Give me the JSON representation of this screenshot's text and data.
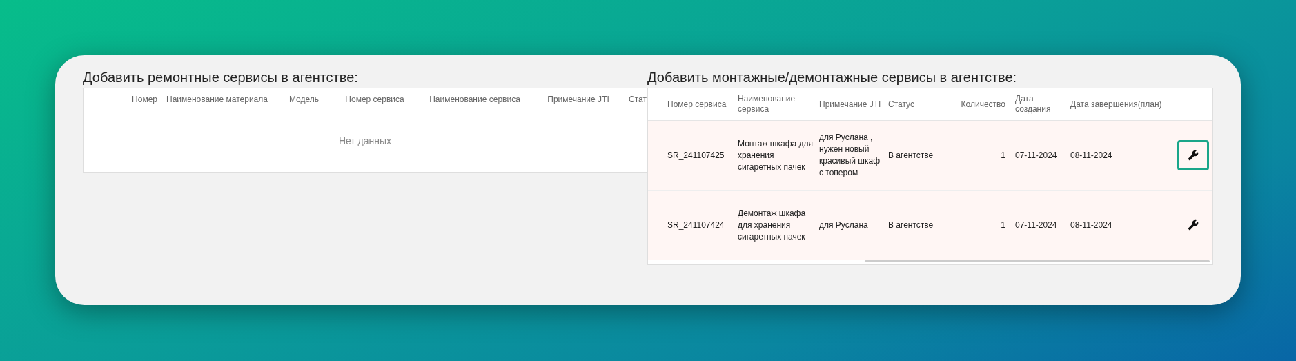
{
  "left_section": {
    "title": "Добавить ремонтные сервисы в агентстве:",
    "table": {
      "columns": [
        "Номер",
        "Наименование материала",
        "Модель",
        "Номер сервиса",
        "Наименование сервиса",
        "Примечание JTI",
        "Стат"
      ],
      "empty_text": "Нет данных"
    }
  },
  "right_section": {
    "title": "Добавить монтажные/демонтажные сервисы в агентстве:",
    "table": {
      "columns": [
        "Номер сервиса",
        "Наименование сервиса",
        "Примечание JTI",
        "Статус",
        "Количество",
        "Дата создания",
        "Дата завершения(план)"
      ],
      "rows": [
        {
          "service_number": "SR_241107425",
          "service_name": "Монтаж шкафа для хранения сигаретных пачек",
          "jti_note": "для Руслана , нужен новый красивый шкаф с топером",
          "status": "В агентстве",
          "quantity": "1",
          "created": "07-11-2024",
          "planned_end": "08-11-2024",
          "action_focused": true
        },
        {
          "service_number": "SR_241107424",
          "service_name": "Демонтаж шкафа для хранения сигаретных пачек",
          "jti_note": "для Руслана",
          "status": "В агентстве",
          "quantity": "1",
          "created": "07-11-2024",
          "planned_end": "08-11-2024",
          "action_focused": false
        }
      ]
    }
  }
}
